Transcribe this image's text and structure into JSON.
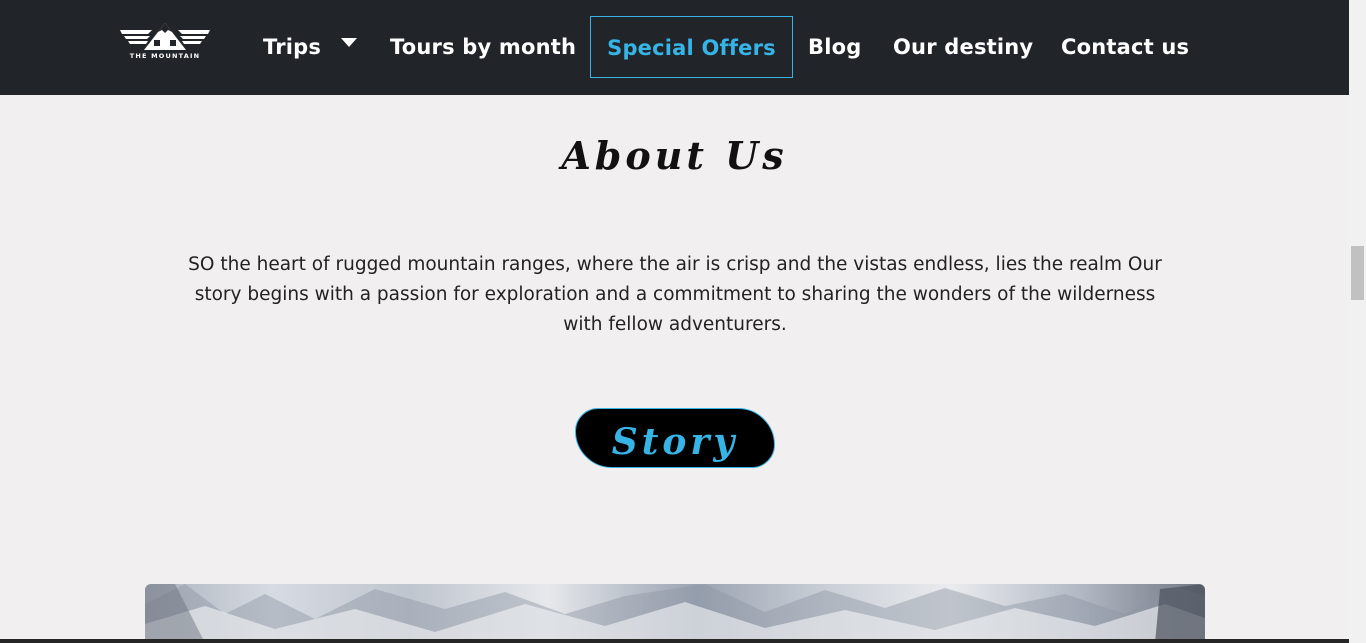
{
  "navbar": {
    "logo_text": "THE MOUNTAIN",
    "items": [
      {
        "label": "Trips"
      },
      {
        "label": "Tours by month"
      },
      {
        "label": "Special Offers"
      },
      {
        "label": "Blog"
      },
      {
        "label": "Our destiny"
      },
      {
        "label": "Contact us"
      }
    ]
  },
  "about": {
    "title": "About Us",
    "text": "SO the heart of rugged mountain ranges, where the air is crisp and the vistas endless, lies the realm Our story begins with a passion for exploration and a commitment to sharing the wonders of the wilderness with fellow adventurers.",
    "button_label": "Story"
  },
  "colors": {
    "navbar_bg": "#212529",
    "accent": "#36b4e6",
    "page_bg": "#f1eff0"
  }
}
